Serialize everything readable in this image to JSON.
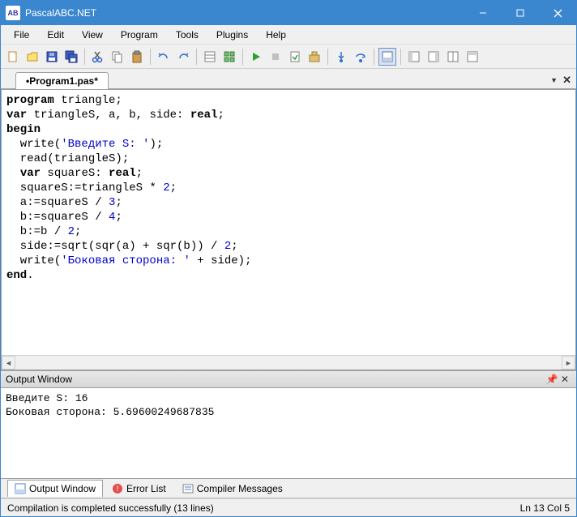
{
  "window": {
    "title": "PascalABC.NET",
    "icon_label": "AB"
  },
  "menu": [
    "File",
    "Edit",
    "View",
    "Program",
    "Tools",
    "Plugins",
    "Help"
  ],
  "tab": {
    "label": "•Program1.pas*"
  },
  "code": {
    "lines": [
      [
        {
          "t": "kw",
          "v": "program"
        },
        {
          "t": "p",
          "v": " triangle;"
        }
      ],
      [
        {
          "t": "kw",
          "v": "var"
        },
        {
          "t": "p",
          "v": " triangleS, a, b, side: "
        },
        {
          "t": "kw",
          "v": "real"
        },
        {
          "t": "p",
          "v": ";"
        }
      ],
      [
        {
          "t": "kw",
          "v": "begin"
        }
      ],
      [
        {
          "t": "p",
          "v": "  write("
        },
        {
          "t": "str",
          "v": "'Введите S: '"
        },
        {
          "t": "p",
          "v": ");"
        }
      ],
      [
        {
          "t": "p",
          "v": "  read(triangleS);"
        }
      ],
      [
        {
          "t": "p",
          "v": "  "
        },
        {
          "t": "kw",
          "v": "var"
        },
        {
          "t": "p",
          "v": " squareS: "
        },
        {
          "t": "kw",
          "v": "real"
        },
        {
          "t": "p",
          "v": ";"
        }
      ],
      [
        {
          "t": "p",
          "v": "  squareS:=triangleS * "
        },
        {
          "t": "num",
          "v": "2"
        },
        {
          "t": "p",
          "v": ";"
        }
      ],
      [
        {
          "t": "p",
          "v": "  a:=squareS / "
        },
        {
          "t": "num",
          "v": "3"
        },
        {
          "t": "p",
          "v": ";"
        }
      ],
      [
        {
          "t": "p",
          "v": "  b:=squareS / "
        },
        {
          "t": "num",
          "v": "4"
        },
        {
          "t": "p",
          "v": ";"
        }
      ],
      [
        {
          "t": "p",
          "v": "  b:=b / "
        },
        {
          "t": "num",
          "v": "2"
        },
        {
          "t": "p",
          "v": ";"
        }
      ],
      [
        {
          "t": "p",
          "v": "  side:=sqrt(sqr(a) + sqr(b)) / "
        },
        {
          "t": "num",
          "v": "2"
        },
        {
          "t": "p",
          "v": ";"
        }
      ],
      [
        {
          "t": "p",
          "v": "  write("
        },
        {
          "t": "str",
          "v": "'Боковая сторона: '"
        },
        {
          "t": "p",
          "v": " + side);"
        }
      ],
      [
        {
          "t": "kw",
          "v": "end"
        },
        {
          "t": "p",
          "v": "."
        }
      ]
    ]
  },
  "output_panel": {
    "title": "Output Window",
    "text": "Введите S: 16\nБоковая сторона: 5.69600249687835"
  },
  "bottom_tabs": [
    {
      "label": "Output Window",
      "active": true
    },
    {
      "label": "Error List",
      "active": false
    },
    {
      "label": "Compiler Messages",
      "active": false
    }
  ],
  "status": {
    "text": "Compilation is completed successfully (13 lines)",
    "pos": "Ln  13  Col  5"
  }
}
